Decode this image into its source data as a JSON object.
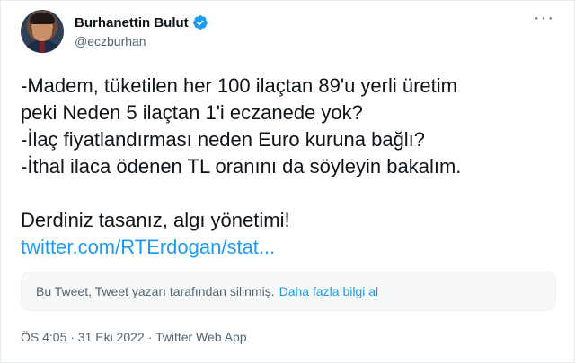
{
  "author": {
    "display_name": "Burhanettin Bulut",
    "handle": "@eczburhan",
    "verified": true
  },
  "more_label": "···",
  "tweet": {
    "lines": [
      "-Madem, tüketilen her 100 ilaçtan 89'u yerli üretim",
      "peki Neden 5 ilaçtan 1'i eczanede yok?",
      "-İlaç fiyatlandırması neden Euro kuruna bağlı?",
      "-İthal ilaca ödenen TL oranını da söyleyin bakalım."
    ],
    "closing": "Derdiniz tasanız, algı yönetimi!",
    "link": "twitter.com/RTErdogan/stat..."
  },
  "quoted_notice": {
    "text": "Bu Tweet, Tweet yazarı tarafından silinmiş.",
    "learn_more": "Daha fazla bilgi al"
  },
  "meta": {
    "timestamp": "ÖS 4:05 · 31 Eki 2022 · Twitter Web App"
  },
  "colors": {
    "accent": "#1d9bf0",
    "text": "#0f1419",
    "secondary": "#536471"
  }
}
